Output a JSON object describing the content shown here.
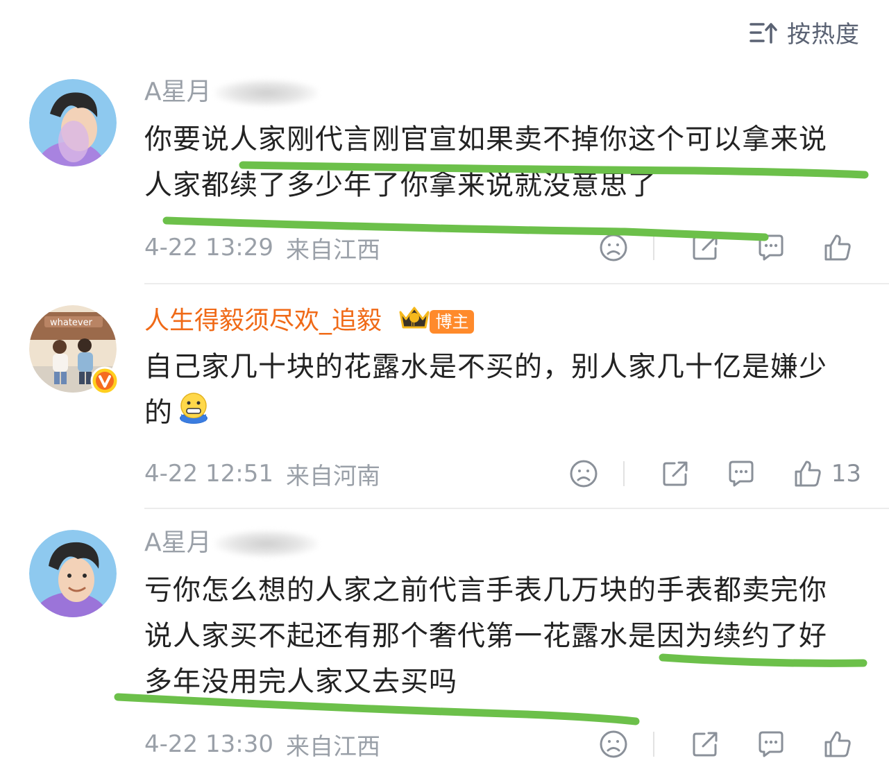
{
  "sort": {
    "label": "按热度",
    "icon": "sort-icon"
  },
  "comments": [
    {
      "username": "A星月",
      "text": "你要说人家刚代言刚官宣如果卖不掉你这个可以拿来说人家都续了多少年了你拿来说就没意思了",
      "time": "4-22 13:29",
      "location": "来自江西",
      "likes": ""
    },
    {
      "username": "人生得毅须尽欢_追毅",
      "badge": "博主",
      "text": "自己家几十块的花露水是不买的，别人家几十亿是嫌少的",
      "emoji": "shivering-face-emoji",
      "time": "4-22 12:51",
      "location": "来自河南",
      "likes": "13",
      "verified_icon": "verified-v-icon"
    },
    {
      "username": "A星月",
      "text": "亏你怎么想的人家之前代言手表几万块的手表都卖完你说人家买不起还有那个奢代第一花露水是因为续约了好多年没用完人家又去买吗",
      "time": "4-22 13:30",
      "location": "来自江西",
      "likes": ""
    }
  ],
  "colors": {
    "highlight": "#6cc04a",
    "vip_name": "#f06a17",
    "meta": "#9aa0a8",
    "badge": "#ff8a2b"
  }
}
